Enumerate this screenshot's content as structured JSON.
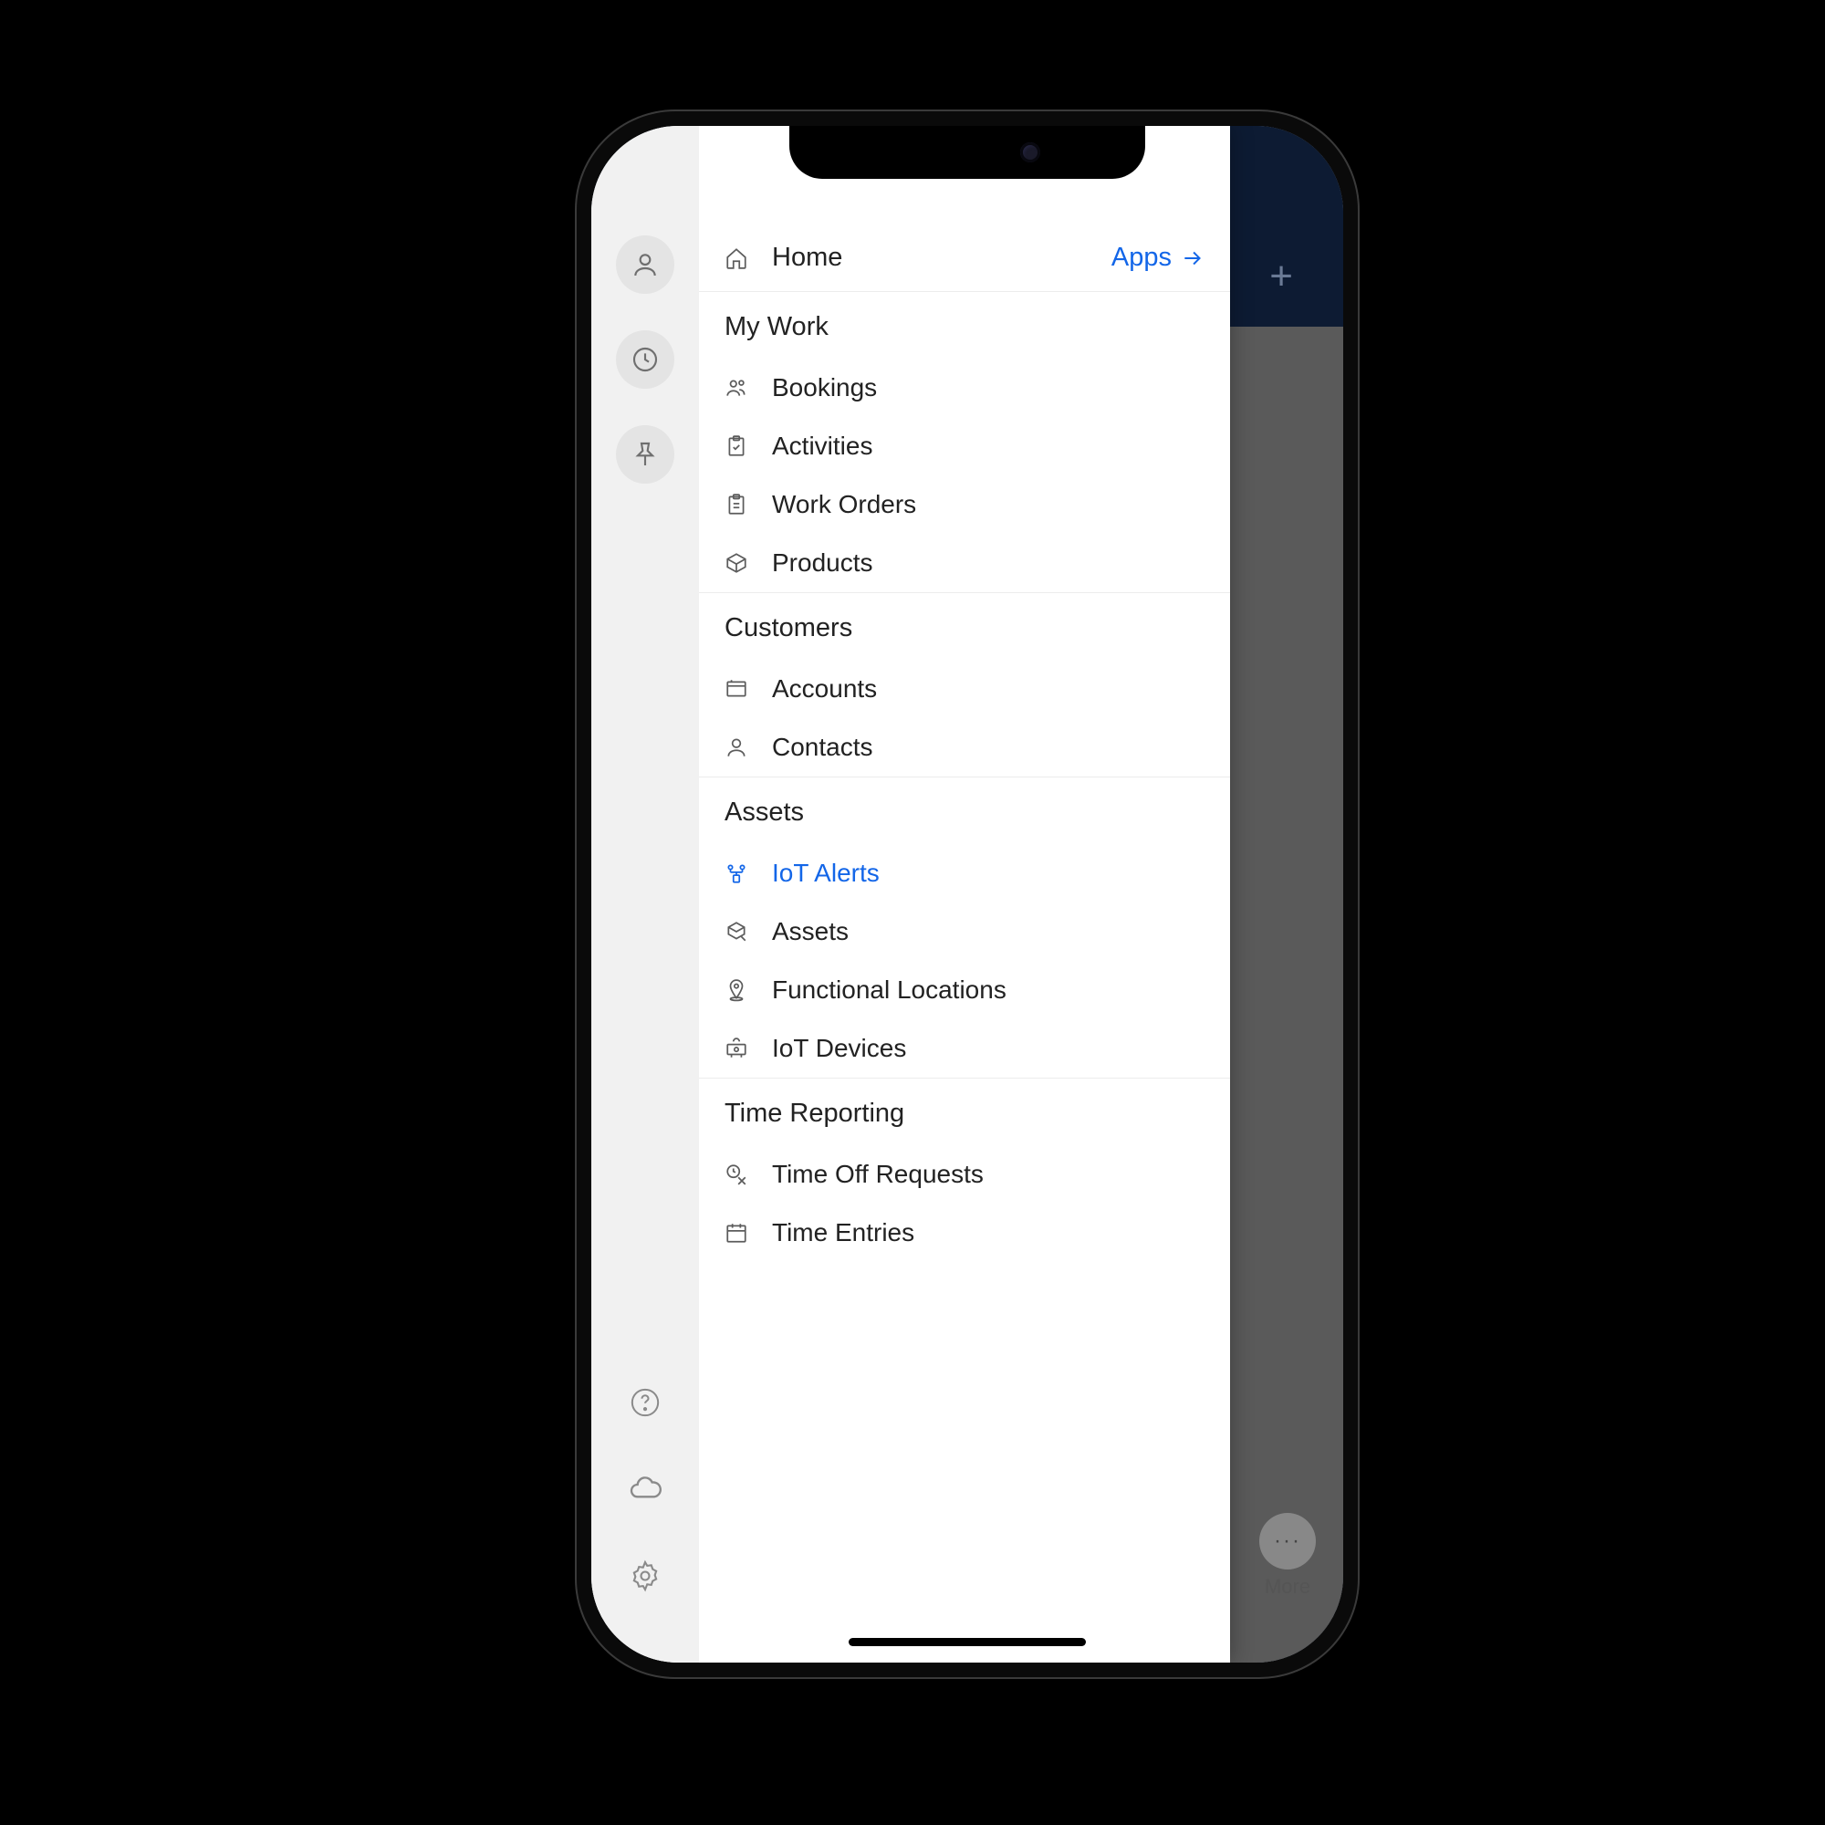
{
  "header": {
    "home_label": "Home",
    "apps_link_label": "Apps"
  },
  "sections": [
    {
      "title": "My Work",
      "items": [
        {
          "label": "Bookings",
          "icon": "people-icon"
        },
        {
          "label": "Activities",
          "icon": "clipboard-check-icon"
        },
        {
          "label": "Work Orders",
          "icon": "clipboard-icon"
        },
        {
          "label": "Products",
          "icon": "box-icon"
        }
      ]
    },
    {
      "title": "Customers",
      "items": [
        {
          "label": "Accounts",
          "icon": "folder-icon"
        },
        {
          "label": "Contacts",
          "icon": "person-icon"
        }
      ]
    },
    {
      "title": "Assets",
      "items": [
        {
          "label": "IoT Alerts",
          "icon": "iot-alert-icon",
          "active": true
        },
        {
          "label": "Assets",
          "icon": "box-edit-icon"
        },
        {
          "label": "Functional Locations",
          "icon": "location-icon"
        },
        {
          "label": "IoT Devices",
          "icon": "device-icon"
        }
      ]
    },
    {
      "title": "Time Reporting",
      "items": [
        {
          "label": "Time Off Requests",
          "icon": "time-request-icon"
        },
        {
          "label": "Time Entries",
          "icon": "calendar-icon"
        }
      ]
    }
  ],
  "rail": {
    "top": [
      "profile-icon",
      "recent-icon",
      "pin-icon"
    ],
    "bottom": [
      "help-icon",
      "cloud-icon",
      "settings-icon"
    ]
  },
  "background": {
    "more_label": "More"
  }
}
